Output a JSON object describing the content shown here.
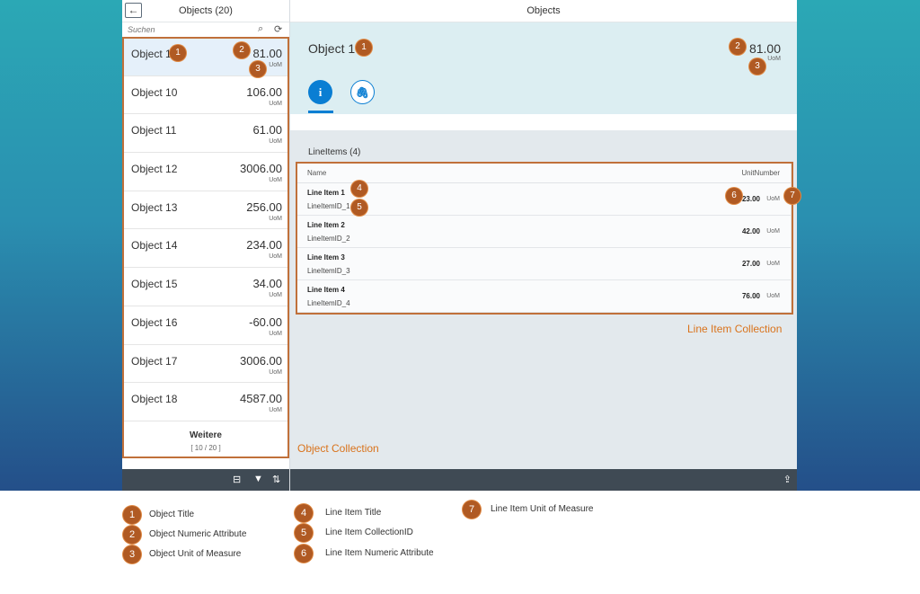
{
  "master": {
    "title": "Objects (20)",
    "back_icon": "←",
    "search_placeholder": "Suchen",
    "items": [
      {
        "title": "Object 1",
        "number": "81.00",
        "uom": "UoM"
      },
      {
        "title": "Object 10",
        "number": "106.00",
        "uom": "UoM"
      },
      {
        "title": "Object 11",
        "number": "61.00",
        "uom": "UoM"
      },
      {
        "title": "Object 12",
        "number": "3006.00",
        "uom": "UoM"
      },
      {
        "title": "Object 13",
        "number": "256.00",
        "uom": "UoM"
      },
      {
        "title": "Object 14",
        "number": "234.00",
        "uom": "UoM"
      },
      {
        "title": "Object 15",
        "number": "34.00",
        "uom": "UoM"
      },
      {
        "title": "Object 16",
        "number": "-60.00",
        "uom": "UoM"
      },
      {
        "title": "Object 17",
        "number": "3006.00",
        "uom": "UoM"
      },
      {
        "title": "Object 18",
        "number": "4587.00",
        "uom": "UoM"
      }
    ],
    "more": {
      "label": "Weitere",
      "count": "[ 10 / 20 ]"
    },
    "footer_icons": [
      "group-icon",
      "filter-icon",
      "sort-icon"
    ]
  },
  "detail": {
    "header_title": "Objects",
    "object": {
      "title": "Object 1",
      "number": "81.00",
      "uom": "UoM"
    },
    "tabs": [
      {
        "icon": "info-icon",
        "glyph": "i"
      },
      {
        "icon": "attachment-icon",
        "glyph": "🖇"
      }
    ],
    "line_items_title": "LineItems (4)",
    "columns": {
      "name": "Name",
      "unit": "UnitNumber"
    },
    "rows": [
      {
        "title": "Line Item 1",
        "id": "LineItemID_1",
        "number": "23.00",
        "uom": "UoM"
      },
      {
        "title": "Line Item 2",
        "id": "LineItemID_2",
        "number": "42.00",
        "uom": "UoM"
      },
      {
        "title": "Line Item 3",
        "id": "LineItemID_3",
        "number": "27.00",
        "uom": "UoM"
      },
      {
        "title": "Line Item 4",
        "id": "LineItemID_4",
        "number": "76.00",
        "uom": "UoM"
      }
    ]
  },
  "captions": {
    "line_item_collection": "Line Item Collection",
    "object_collection": "Object Collection"
  },
  "badges": [
    "1",
    "2",
    "3",
    "4",
    "5",
    "6",
    "7"
  ],
  "legend": [
    {
      "num": "1",
      "label": "Object Title"
    },
    {
      "num": "2",
      "label": "Object Numeric Attribute"
    },
    {
      "num": "3",
      "label": "Object Unit of Measure"
    },
    {
      "num": "4",
      "label": "Line Item Title"
    },
    {
      "num": "5",
      "label": "Line Item CollectionID"
    },
    {
      "num": "6",
      "label": "Line Item Numeric Attribute"
    },
    {
      "num": "7",
      "label": "Line Item Unit of Measure"
    }
  ],
  "colors": {
    "accent": "#0a7ed3",
    "badge": "#b05a23",
    "frame": "#c0703a",
    "caption": "#d9731c"
  }
}
